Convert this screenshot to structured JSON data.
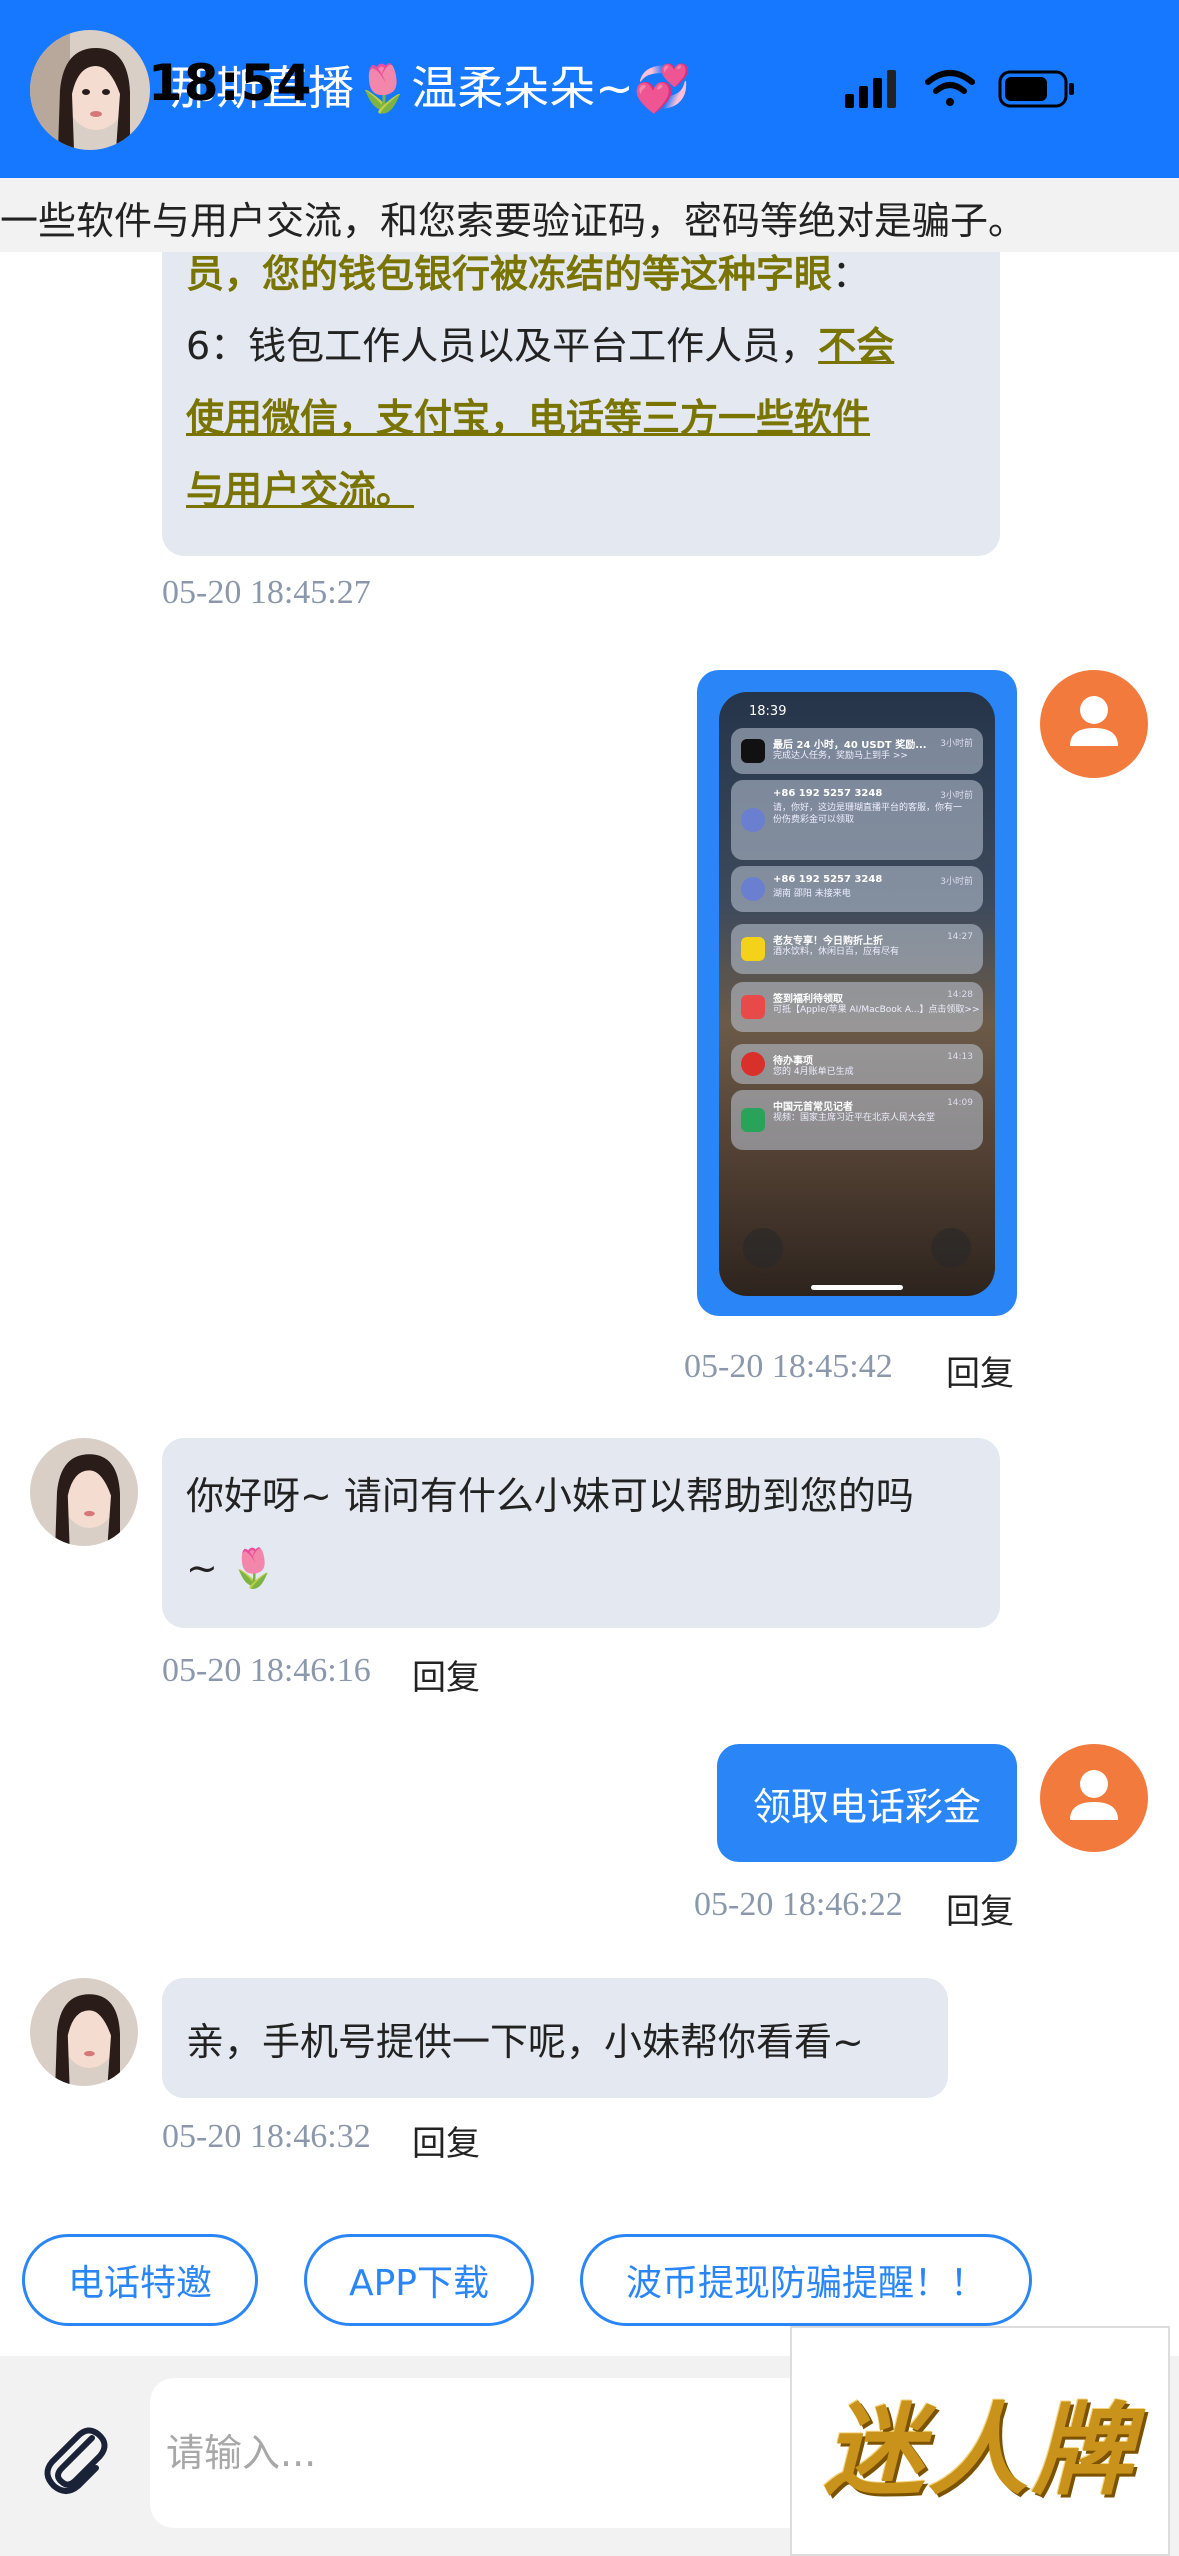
{
  "status_bar": {
    "time": "18:54"
  },
  "header": {
    "title": "那斯直播🌷温柔朵朵~💞"
  },
  "notice": {
    "text": "一些软件与用户交流，和您索要验证码，密码等绝对是骗子。"
  },
  "messages": {
    "m1": {
      "line1": "员，您的钱包银行被冻结的等这种字眼",
      "line1_tail": "：",
      "line2_prefix": "6：钱包工作人员以及平台工作人员，",
      "line2_link": "不会",
      "line3": "使用微信，支付宝，电话等三方一些软件",
      "line4": "与用户交流。",
      "time": "05-20 18:45:27"
    },
    "m2": {
      "time": "05-20 18:45:42",
      "reply": "回复",
      "screenshot": {
        "time": "18:39",
        "notifications": [
          {
            "title": "最后 24 小时，40 USDT 奖励...",
            "body": "完成达人任务，奖励马上到手 >>",
            "time": "3小时前",
            "color": "#111111"
          },
          {
            "title": "+86 192 5257 3248",
            "body": "请，你好，这边是珊瑚直播平台的客服，你有一份伤费彩金可以领取",
            "time": "3小时前",
            "color": "#6a7fd0"
          },
          {
            "title": "+86 192 5257 3248",
            "body": "湖南 邵阳 未接来电",
            "time": "3小时前",
            "color": "#6a7fd0"
          },
          {
            "title": "老友专享！今日购折上折",
            "body": "酒水饮料，休闲日百，应有尽有",
            "time": "14:27",
            "color": "#f5d21a"
          },
          {
            "title": "签到福利待领取",
            "body": "可抵【Apple/苹果 AI/MacBook A...】点击领取>>",
            "time": "14:28",
            "color": "#e84a4a"
          },
          {
            "title": "待办事项",
            "body": "您的 4月账单已生成",
            "time": "14:13",
            "color": "#d8302a"
          },
          {
            "title": "中国元首常见记者",
            "body": "视频：国家主席习近平在北京人民大会堂",
            "time": "14:09",
            "color": "#2aa35a"
          }
        ]
      }
    },
    "m3": {
      "text_line1": "你好呀~ 请问有什么小妹可以帮助到您的吗",
      "text_line2": "~ 🌷",
      "time": "05-20 18:46:16",
      "reply": "回复"
    },
    "m4": {
      "text": "领取电话彩金",
      "time": "05-20 18:46:22",
      "reply": "回复"
    },
    "m5": {
      "text": "亲，手机号提供一下呢，小妹帮你看看~",
      "time": "05-20 18:46:32",
      "reply": "回复"
    }
  },
  "quick_actions": {
    "btn1": "电话特邀",
    "btn2": "APP下载",
    "btn3": "波币提现防骗提醒！！"
  },
  "input": {
    "placeholder": "请输入..."
  },
  "brand": {
    "text": "迷人牌"
  },
  "colors": {
    "header": "#1677ff",
    "bubble_right": "#2a86f7",
    "bubble_left": "#e3e8f1",
    "user_avatar": "#f27a3d",
    "warning_text": "#7a7500"
  }
}
